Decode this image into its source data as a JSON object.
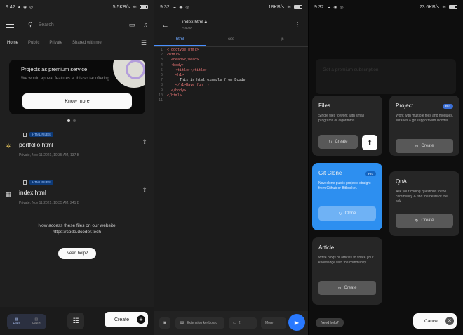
{
  "screens": {
    "home": {
      "status": {
        "time": "9:42",
        "right": "5.5KB/s"
      },
      "search": {
        "placeholder": "Search"
      },
      "tabs": [
        "Home",
        "Public",
        "Private",
        "Shared with me"
      ],
      "promo": {
        "title": "Projects as premium service",
        "subtitle": "We would appear features at this so far offering.",
        "button": "Know more"
      },
      "files": [
        {
          "tag": "HTML FILES",
          "name": "portfolio.html",
          "meta": "Private, Nov 11 2021, 10:35 AM, 137 B"
        },
        {
          "tag": "HTML FILES",
          "name": "index.html",
          "meta": "Private, Nov 11 2021, 10:35 AM, 241 B"
        }
      ],
      "promo_text": {
        "line1": "Now access these files on our website",
        "line2": "https://code.dcoder.tech"
      },
      "need_help": "Need help?",
      "nav": {
        "files": "Files",
        "feed": "Feed",
        "create": "Create"
      }
    },
    "editor": {
      "status": {
        "time": "9:32",
        "right": "18KB/s"
      },
      "title": "index.html",
      "saved": "Saved",
      "tabs": [
        "html",
        "css",
        "js"
      ],
      "code": [
        {
          "n": "1",
          "text": "<!doctype html>"
        },
        {
          "n": "2",
          "text": "<html>"
        },
        {
          "n": "3",
          "text": "  <head></head>"
        },
        {
          "n": "4",
          "text": "  <body>"
        },
        {
          "n": "5",
          "text": "    <title></title>"
        },
        {
          "n": "6",
          "text": "    <h1>"
        },
        {
          "n": "7",
          "text": "      This is html example from Dcoder",
          "plain": true
        },
        {
          "n": "8",
          "text": "    </h1>Have fun :)"
        },
        {
          "n": "9",
          "text": "  </body>"
        },
        {
          "n": "10",
          "text": "</html>"
        },
        {
          "n": "11",
          "text": ""
        }
      ],
      "bottom": {
        "ext": "Extension keyboard",
        "num": "2",
        "extra": "More"
      }
    },
    "create": {
      "status": {
        "time": "9:32",
        "right": "23.6KB/s"
      },
      "bg_text": "Get a premium subscription",
      "cards": {
        "files": {
          "title": "Files",
          "desc": "Single files to work with small programs or algorithms.",
          "button": "Create"
        },
        "project": {
          "title": "Project",
          "badge": "Pro",
          "desc": "Work with multiple files and modules, libraries & git support with Dcoder.",
          "button": "Create"
        },
        "git": {
          "title": "Git Clone",
          "badge": "Pro",
          "desc": "Now clone public projects straight from Github or Bitbucket.",
          "button": "Clone"
        },
        "qna": {
          "title": "QnA",
          "desc": "Ask your coding questions to the community & find the bests of the ask.",
          "button": "Create"
        },
        "article": {
          "title": "Article",
          "desc": "Write blogs or articles to share your knowledge with the community.",
          "button": "Create"
        }
      },
      "need_help": "Need help?",
      "cancel": "Cancel"
    }
  },
  "colors": {
    "accent": "#2d8ff0",
    "tag": "#0d3a78",
    "code": "#e57373"
  }
}
